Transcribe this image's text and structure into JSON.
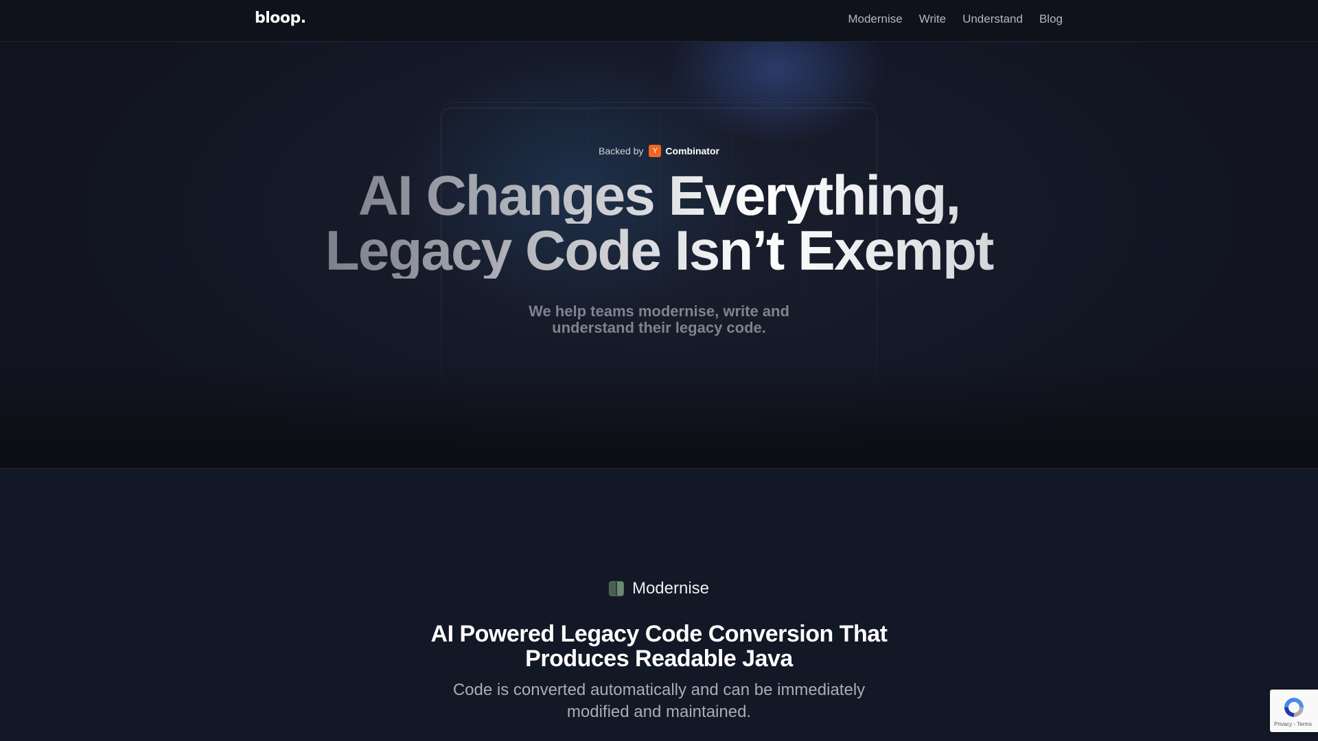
{
  "nav": {
    "logo": "bloop.",
    "links": [
      "Modernise",
      "Write",
      "Understand",
      "Blog"
    ]
  },
  "hero": {
    "backed_prefix": "Backed by",
    "yc_badge": "Y",
    "backer_name": "Combinator",
    "headline_line1": "AI Changes Everything,",
    "headline_line2": "Legacy Code Isn’t Exempt",
    "subhead_line1": "We help teams modernise, write and",
    "subhead_line2": "understand their legacy code."
  },
  "feature": {
    "label": "Modernise",
    "icon": "modernise-icon",
    "title_line1": "AI Powered Legacy Code Conversion That",
    "title_line2": "Produces Readable Java",
    "desc_line1": "Code is converted automatically and can be immediately",
    "desc_line2": "modified and maintained."
  },
  "recaptcha": {
    "text": "Privacy - Terms"
  },
  "colors": {
    "nav_bg": "#0f121b",
    "section_bg": "#131826",
    "yc_orange": "#f26522"
  }
}
